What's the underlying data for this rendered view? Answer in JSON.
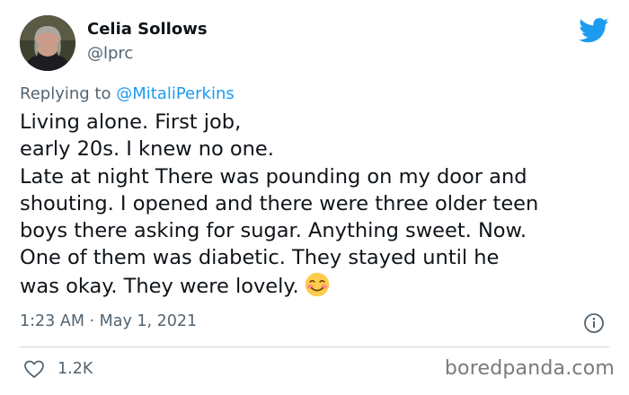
{
  "author": {
    "display_name": "Celia Sollows",
    "handle": "@lprc"
  },
  "reply": {
    "prefix": "Replying to",
    "mention": "@MitaliPerkins"
  },
  "tweet": {
    "lines": [
      "Living alone. First job,",
      "early 20s. I knew no one.",
      "Late at night There was pounding on my door and",
      "shouting. I opened and there were three older teen",
      "boys there asking for sugar. Anything sweet. Now.",
      "One of them was diabetic. They stayed until he",
      "was okay. They were lovely."
    ],
    "emoji": "smiling-face-with-blush"
  },
  "meta": {
    "timestamp": "1:23 AM · May 1, 2021"
  },
  "actions": {
    "like_count": "1.2K"
  },
  "watermark": "boredpanda.com",
  "colors": {
    "twitter_blue": "#1d9bf0",
    "text_primary": "#0f1419",
    "text_secondary": "#536471",
    "divider": "#cfd9de"
  }
}
